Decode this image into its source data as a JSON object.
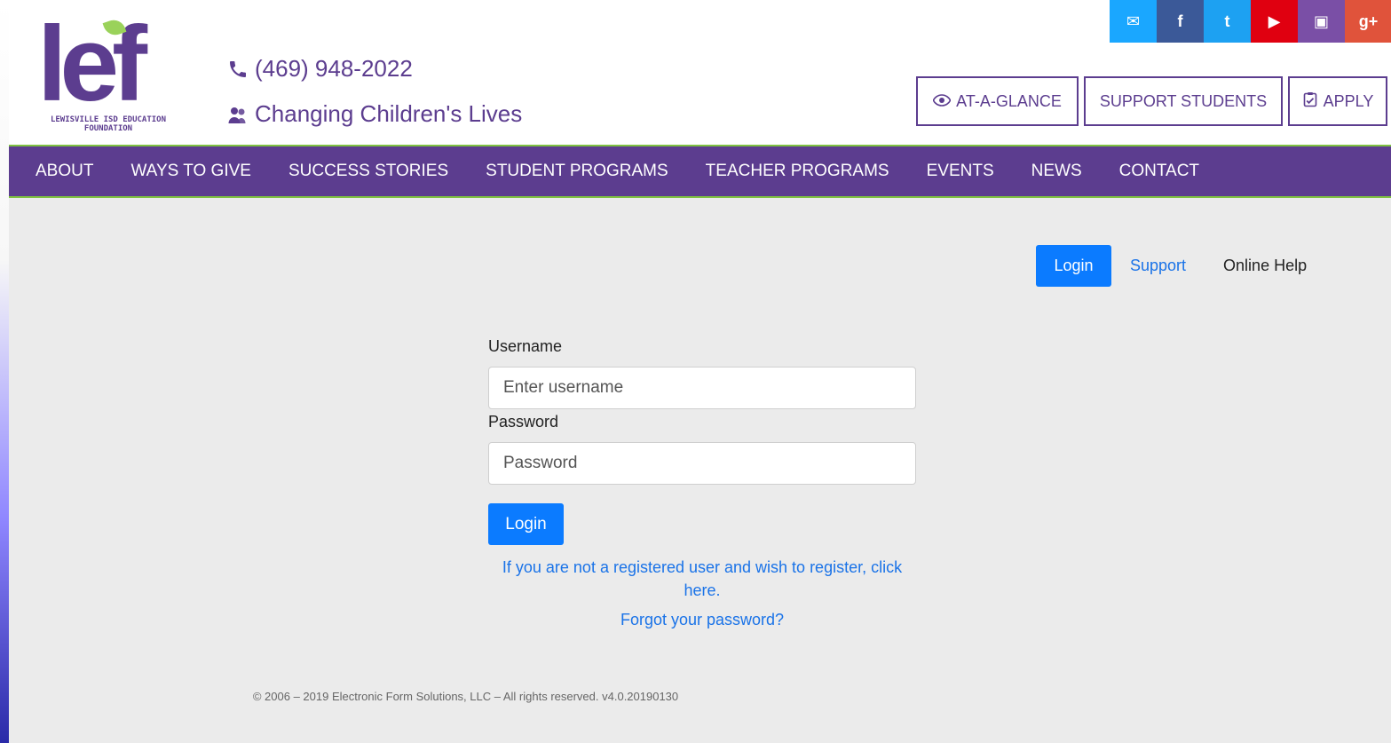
{
  "brand": {
    "logo_text": "lef",
    "logo_sub": "LEWISVILLE ISD EDUCATION FOUNDATION"
  },
  "header": {
    "phone": "(469) 948-2022",
    "tagline": "Changing Children's Lives",
    "cta": [
      "AT-A-GLANCE",
      "SUPPORT STUDENTS",
      "APPLY"
    ],
    "social": [
      {
        "name": "email",
        "glyph": "✉",
        "color": "#1aa7ff"
      },
      {
        "name": "facebook",
        "glyph": "f",
        "color": "#3b5998"
      },
      {
        "name": "twitter",
        "glyph": "t",
        "color": "#1da1f2"
      },
      {
        "name": "youtube",
        "glyph": "▶",
        "color": "#e00010"
      },
      {
        "name": "instagram",
        "glyph": "▣",
        "color": "#7a4fa6"
      },
      {
        "name": "google-plus",
        "glyph": "g+",
        "color": "#e0533b"
      }
    ]
  },
  "nav": {
    "items": [
      "ABOUT",
      "WAYS TO GIVE",
      "SUCCESS STORIES",
      "STUDENT PROGRAMS",
      "TEACHER PROGRAMS",
      "EVENTS",
      "NEWS",
      "CONTACT"
    ]
  },
  "top_links": {
    "login": "Login",
    "support": "Support",
    "help": "Online Help"
  },
  "form": {
    "username_label": "Username",
    "username_placeholder": "Enter username",
    "password_label": "Password",
    "password_placeholder": "Password",
    "login_button": "Login",
    "register_text": "If you are not a registered user and wish to register, click here.",
    "forgot_text": "Forgot your password?"
  },
  "footer": {
    "text": "© 2006 – 2019 Electronic Form Solutions, LLC – All rights reserved.  v4.0.20190130"
  }
}
